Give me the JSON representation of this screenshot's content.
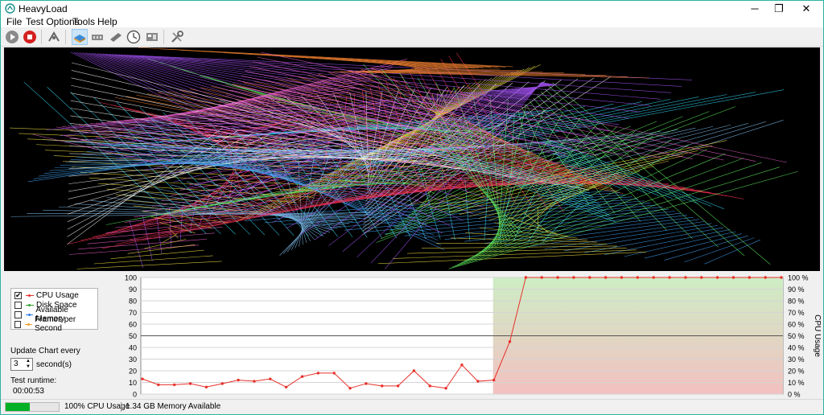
{
  "window": {
    "title": "HeavyLoad",
    "minimize_icon": "─",
    "restore_icon": "❐",
    "close_icon": "✕"
  },
  "menu": [
    "File",
    "Test Options",
    "Tools",
    "Help"
  ],
  "toolbar": {
    "icons": [
      "start-icon",
      "stop-icon",
      "cpu-icon",
      "disk-icon",
      "memory-icon",
      "gpu-icon",
      "clock-icon",
      "monitor-icon",
      "tools-icon"
    ],
    "active": "disk-icon"
  },
  "legend": {
    "items": [
      {
        "label": "CPU Usage",
        "checked": true,
        "color": "#e8302a"
      },
      {
        "label": "Disk Space",
        "checked": false,
        "color": "#30a030"
      },
      {
        "label": "Available Memory",
        "checked": false,
        "color": "#2a7ae8"
      },
      {
        "label": "Frames per Second",
        "checked": false,
        "color": "#f0a020"
      }
    ],
    "checkmark": "✔"
  },
  "update_chart": {
    "label": "Update Chart every",
    "value": "3",
    "unit": "second(s)",
    "spin_up": "▲",
    "spin_down": "▼"
  },
  "runtime": {
    "label": "Test runtime:",
    "value": "00:00:53"
  },
  "status": {
    "progress": 0.45,
    "cpu_text": "100% CPU Usage",
    "memory_text": "1.34 GB Memory Available"
  },
  "chart_data": {
    "type": "line",
    "series": [
      {
        "name": "CPU Usage",
        "color": "#e8302a",
        "values": [
          13,
          8,
          8,
          9,
          6,
          9,
          12,
          11,
          13,
          6,
          15,
          18,
          18,
          5,
          9,
          7,
          7,
          20,
          7,
          5,
          25,
          11,
          12,
          45,
          100,
          100,
          100,
          100,
          100,
          100,
          100,
          100,
          100,
          100,
          100,
          100,
          100,
          100,
          100,
          100,
          100
        ]
      }
    ],
    "left_ticks": [
      "0",
      "10",
      "20",
      "30",
      "40",
      "50",
      "60",
      "70",
      "80",
      "90",
      "100"
    ],
    "right_ticks": [
      "0 %",
      "10 %",
      "20 %",
      "30 %",
      "40 %",
      "50 %",
      "60 %",
      "70 %",
      "80 %",
      "90 %",
      "100 %"
    ],
    "ylabel_right": "CPU Usage",
    "ylim": [
      0,
      100
    ],
    "reference_line": 50,
    "load_start_index": 22,
    "grid": true
  }
}
